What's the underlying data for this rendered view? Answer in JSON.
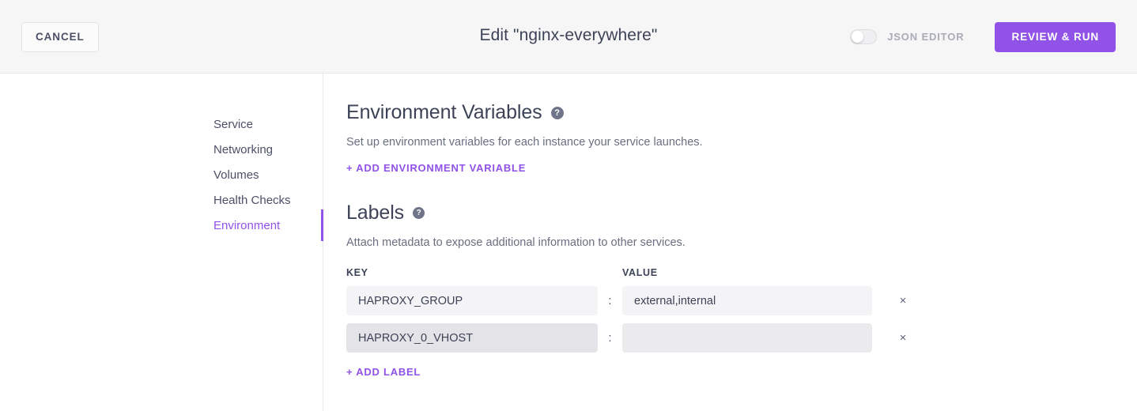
{
  "header": {
    "cancel_label": "CANCEL",
    "title": "Edit \"nginx-everywhere\"",
    "json_editor_label": "JSON EDITOR",
    "json_editor_state": "off",
    "review_run_label": "REVIEW & RUN",
    "accent_color": "#9152e8",
    "background": "#f6f6f7"
  },
  "sidebar": {
    "items": [
      {
        "label": "Service",
        "active": false
      },
      {
        "label": "Networking",
        "active": false
      },
      {
        "label": "Volumes",
        "active": false
      },
      {
        "label": "Health Checks",
        "active": false
      },
      {
        "label": "Environment",
        "active": true
      }
    ]
  },
  "main": {
    "env_section": {
      "title": "Environment Variables",
      "help_icon": "question-mark-icon",
      "help_glyph": "?",
      "description": "Set up environment variables for each instance your service launches.",
      "add_label": "+ ADD ENVIRONMENT VARIABLE"
    },
    "labels_section": {
      "title": "Labels",
      "help_icon": "question-mark-icon",
      "help_glyph": "?",
      "description": "Attach metadata to expose additional information to other services.",
      "columns": {
        "key": "KEY",
        "value": "VALUE"
      },
      "separator": ":",
      "remove_glyph": "×",
      "rows": [
        {
          "key": "HAPROXY_GROUP",
          "value": "external,internal",
          "key_placeholder": "",
          "value_placeholder": "",
          "hovered": false
        },
        {
          "key": "HAPROXY_0_VHOST",
          "value": "",
          "key_placeholder": "",
          "value_placeholder": "",
          "hovered": true
        }
      ],
      "add_label": "+ ADD LABEL"
    }
  }
}
